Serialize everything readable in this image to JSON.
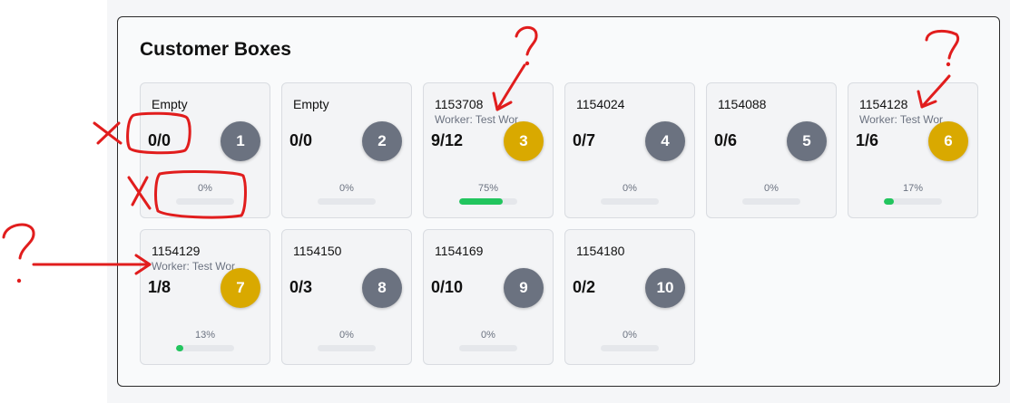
{
  "title": "Customer Boxes",
  "colors": {
    "occupied": "#d9a900",
    "idle": "#6b7280",
    "progress": "#22c55e",
    "annotation": "#e11d1d"
  },
  "boxes": [
    {
      "name": "Empty",
      "worker": "",
      "count": "0/0",
      "number": "1",
      "occupied": false,
      "percent": "0%",
      "progress": 0.0
    },
    {
      "name": "Empty",
      "worker": "",
      "count": "0/0",
      "number": "2",
      "occupied": false,
      "percent": "0%",
      "progress": 0.0
    },
    {
      "name": "1153708",
      "worker": "Worker: Test Wor",
      "count": "9/12",
      "number": "3",
      "occupied": true,
      "percent": "75%",
      "progress": 0.75
    },
    {
      "name": "1154024",
      "worker": "",
      "count": "0/7",
      "number": "4",
      "occupied": false,
      "percent": "0%",
      "progress": 0.0
    },
    {
      "name": "1154088",
      "worker": "",
      "count": "0/6",
      "number": "5",
      "occupied": false,
      "percent": "0%",
      "progress": 0.0
    },
    {
      "name": "1154128",
      "worker": "Worker: Test Wor",
      "count": "1/6",
      "number": "6",
      "occupied": true,
      "percent": "17%",
      "progress": 0.17
    },
    {
      "name": "1154129",
      "worker": "Worker: Test Wor",
      "count": "1/8",
      "number": "7",
      "occupied": true,
      "percent": "13%",
      "progress": 0.13
    },
    {
      "name": "1154150",
      "worker": "",
      "count": "0/3",
      "number": "8",
      "occupied": false,
      "percent": "0%",
      "progress": 0.0
    },
    {
      "name": "1154169",
      "worker": "",
      "count": "0/10",
      "number": "9",
      "occupied": false,
      "percent": "0%",
      "progress": 0.0
    },
    {
      "name": "1154180",
      "worker": "",
      "count": "0/2",
      "number": "10",
      "occupied": false,
      "percent": "0%",
      "progress": 0.0
    }
  ],
  "annotations": [
    {
      "kind": "question-mark-icon",
      "target": "box 3 worker label"
    },
    {
      "kind": "question-mark-icon",
      "target": "box 6 worker label"
    },
    {
      "kind": "question-mark-icon",
      "target": "box 7 worker label"
    },
    {
      "kind": "cross-icon",
      "target": "box 1 count"
    },
    {
      "kind": "cross-icon",
      "target": "box 1 progress"
    }
  ]
}
